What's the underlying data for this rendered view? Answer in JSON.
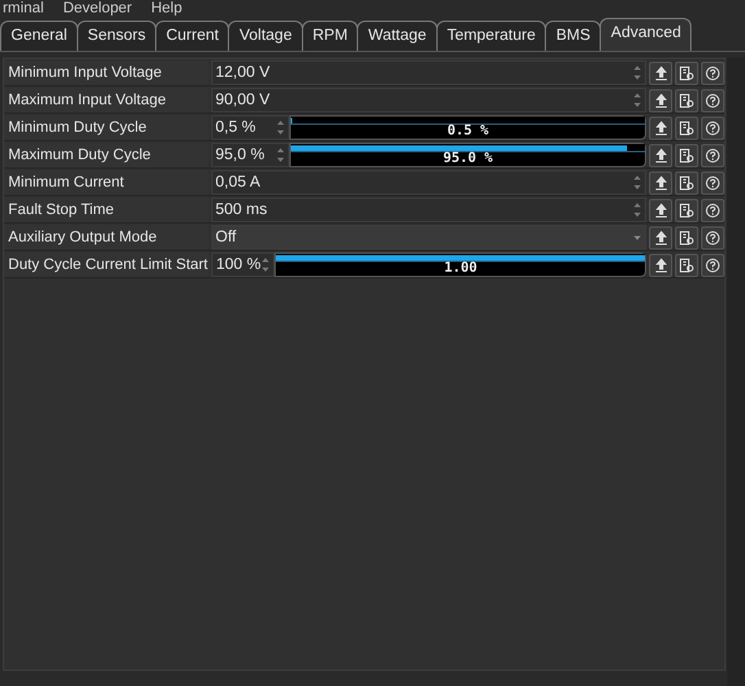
{
  "menu": [
    "rminal",
    "Developer",
    "Help"
  ],
  "tabs": [
    {
      "label": "General",
      "selected": false
    },
    {
      "label": "Sensors",
      "selected": false
    },
    {
      "label": "Current",
      "selected": false
    },
    {
      "label": "Voltage",
      "selected": false
    },
    {
      "label": "RPM",
      "selected": false
    },
    {
      "label": "Wattage",
      "selected": false
    },
    {
      "label": "Temperature",
      "selected": false
    },
    {
      "label": "BMS",
      "selected": false
    },
    {
      "label": "Advanced",
      "selected": true
    }
  ],
  "rows": [
    {
      "kind": "spin",
      "label": "Minimum Input Voltage",
      "value": "12,00 V"
    },
    {
      "kind": "spin",
      "label": "Maximum Input Voltage",
      "value": "90,00 V"
    },
    {
      "kind": "bar",
      "label": "Minimum Duty Cycle",
      "value": "0,5 %",
      "level": 0.005,
      "reading": "0.5 %"
    },
    {
      "kind": "bar",
      "label": "Maximum Duty Cycle",
      "value": "95,0 %",
      "level": 0.95,
      "reading": "95.0 %"
    },
    {
      "kind": "spin",
      "label": "Minimum Current",
      "value": "0,05 A"
    },
    {
      "kind": "spin",
      "label": "Fault Stop Time",
      "value": "500 ms"
    },
    {
      "kind": "combo",
      "label": "Auxiliary Output Mode",
      "value": "Off"
    },
    {
      "kind": "bar",
      "label": "Duty Cycle Current Limit Start",
      "value": "100 %",
      "level": 1.0,
      "reading": "1.00"
    }
  ]
}
